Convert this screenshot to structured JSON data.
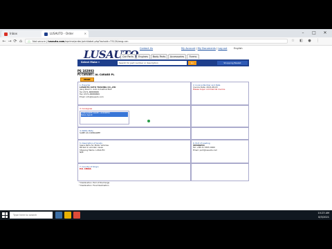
{
  "browser": {
    "tabs": [
      {
        "title": "Inbox",
        "color": "#d93025"
      },
      {
        "title": "LUSAUTO - Order",
        "color": "#1e3f8c"
      }
    ],
    "url_prefix": "Not secure | ",
    "url_host": "lusauto.com",
    "url_path": "/eprime/order/printlabel.php?autoid=7312&lang=en",
    "nav": {
      "back": "←",
      "forward": "→",
      "reload": "⟳",
      "home": "⌂"
    },
    "window": {
      "minimize": "–",
      "maximize": "□",
      "close": "✕"
    }
  },
  "site": {
    "brand": "LUSAUTO",
    "tagline": "Powered by Anonymous",
    "top_links": {
      "help": "Contact Us",
      "account": "My Account",
      "my_documents": "My Documents",
      "logout": "Log out",
      "lang": "English"
    },
    "nav_tabs": [
      "Car Parts",
      "Engines",
      "Body Parts",
      "Accessories",
      "Forms"
    ],
    "select_make": "Select Make",
    "search_placeholder": "Search for part number or description",
    "go": "Go",
    "basket": "Shopping Basket"
  },
  "doc": {
    "title": "PS 182003",
    "subtitle": "PL CARAB3 / AL CARAB3 PL",
    "print_button": "PRINT",
    "shipper": {
      "label": "1. Exporter",
      "lines": [
        "LUSAUTO AUTO TRADING CO.,LTD",
        "",
        "Jiang Road 1, Auto Industrial Park",
        "Tel: 0571-88888888",
        "Fax: 0571-88888889",
        "Email: info@lusauto.com"
      ]
    },
    "invoice": {
      "label": "2. Invoice Number and Date",
      "lines": [
        "Invoice Date: 2021-08-03",
        "Please buyer commercial invoice."
      ]
    },
    "consignee": {
      "label": "3. Consignee",
      "lines": [
        "CONSIGNEE NAME / ADDRESS",
        "Sales Agent"
      ]
    },
    "notify": {
      "label": "4. Notify Party",
      "lines": [
        "SAME AS CONSIGNEE"
      ]
    },
    "description": {
      "label": "5. Description of Goods",
      "lines": [
        "Spare Parts for Motor Vehicles",
        "Packed in wooden cases",
        "Shipping Marks: LUSAUTO",
        "",
        "N/M"
      ]
    },
    "port": {
      "label": "6. Port of Loading",
      "lines": [
        "SHANGHAI",
        "Tel: +86 21 5555 0000",
        "Email: port@lusauto.com"
      ]
    },
    "bottom_label": "7. Country of Origin",
    "bottom_value": "P.R. CHINA",
    "bottom_notes": [
      "* Destination: Port of Discharge",
      "* Destination: Final Destination"
    ]
  },
  "taskbar": {
    "search": "Type here to search",
    "time": "10:23 AM",
    "date": "8/3/2021"
  }
}
